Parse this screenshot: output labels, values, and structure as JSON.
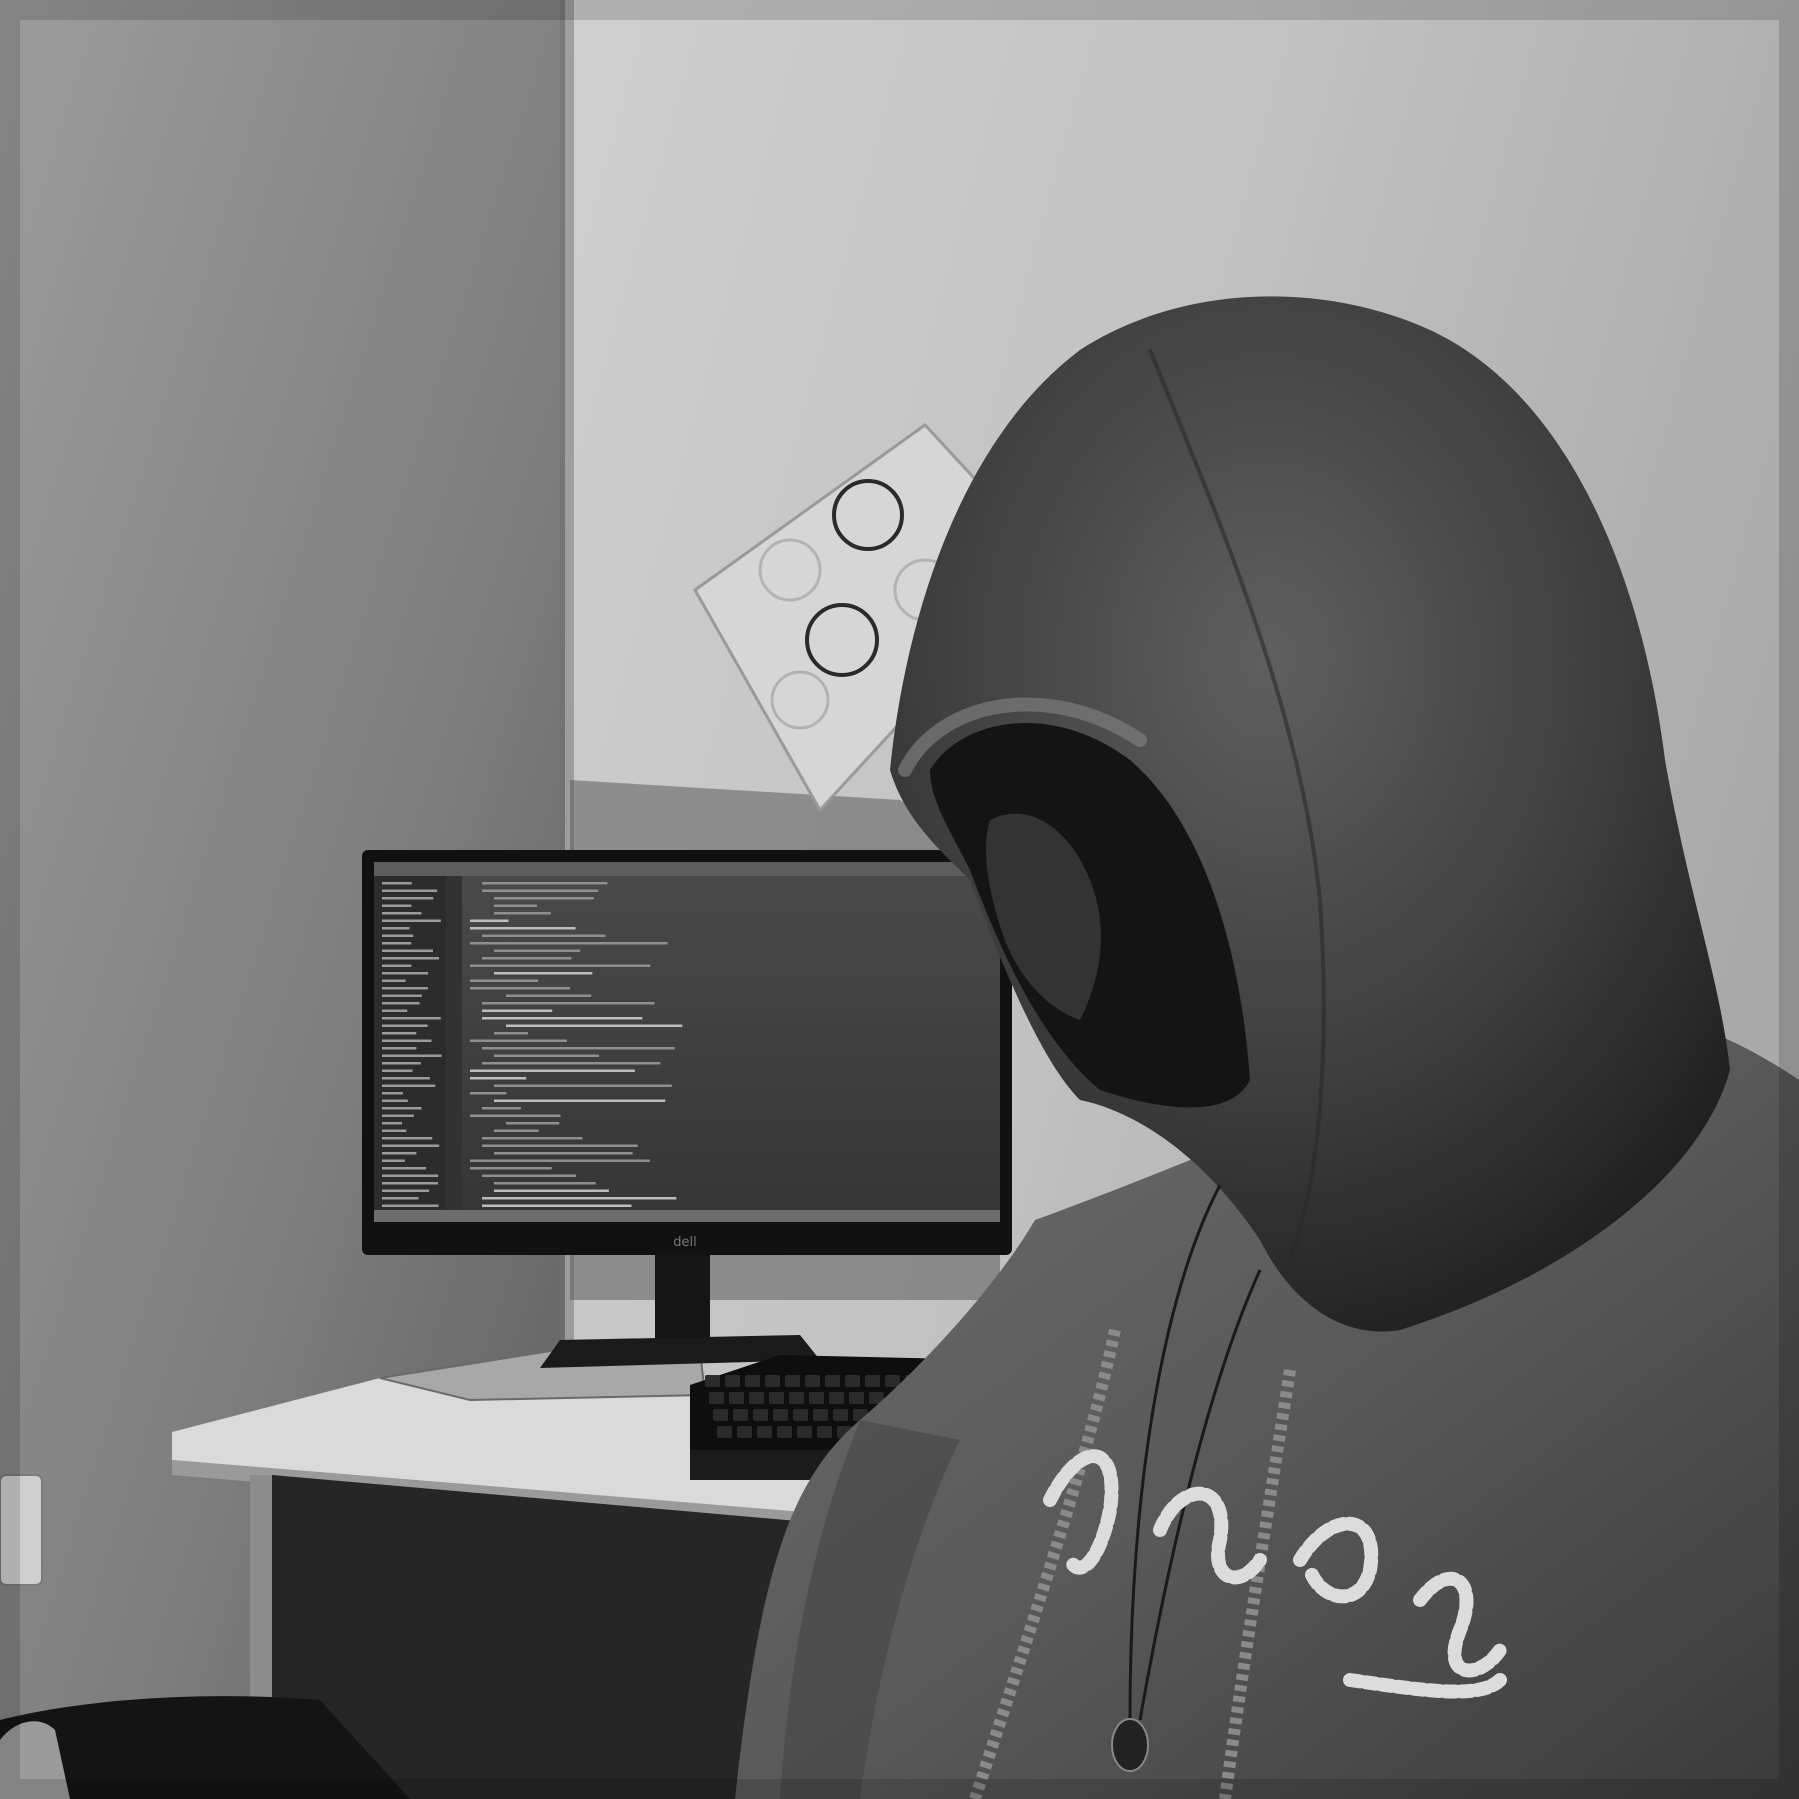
{
  "photo": {
    "monitor_brand": "dell",
    "colors": {
      "wall_left": "#8a8a8a",
      "wall_right": "#c4c4c4",
      "screen_bg": "#3f3f3f",
      "hoodie": "#5a5a5a",
      "desk": "#d8d8d8",
      "shadow": "#161616"
    }
  }
}
